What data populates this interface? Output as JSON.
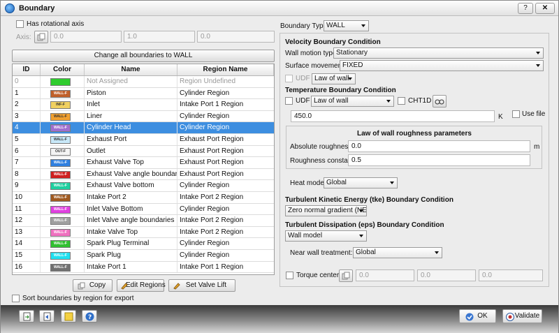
{
  "window": {
    "title": "Boundary",
    "help_label": "?",
    "close_label": "✕"
  },
  "left": {
    "rot_axis_label": "Has rotational axis",
    "axis_label": "Axis:",
    "axis_values": [
      "0.0",
      "1.0",
      "0.0"
    ],
    "change_all_label": "Change all boundaries to WALL",
    "table": {
      "headers": {
        "id": "ID",
        "color": "Color",
        "name": "Name",
        "region": "Region Name"
      },
      "rows": [
        {
          "id": "0",
          "tag": "",
          "color": "#2ecc2e",
          "name": "Not Assigned",
          "region": "Region Undefined"
        },
        {
          "id": "1",
          "tag": "WALL-F",
          "color": "#c0602a",
          "name": "Piston",
          "region": "Cylinder Region"
        },
        {
          "id": "2",
          "tag": "INF-F",
          "color": "#f0d060",
          "name": "Inlet",
          "region": "Intake Port 1 Region"
        },
        {
          "id": "3",
          "tag": "WALL-F",
          "color": "#f0a030",
          "name": "Liner",
          "region": "Cylinder Region"
        },
        {
          "id": "4",
          "tag": "WALL-F",
          "color": "#a070d0",
          "name": "Cylinder Head",
          "region": "Cylinder Region"
        },
        {
          "id": "5",
          "tag": "WALL-F",
          "color": "#c8e8f8",
          "name": "Exhaust Port",
          "region": "Exhaust Port Region"
        },
        {
          "id": "6",
          "tag": "OUT-F",
          "color": "#f4f4f4",
          "name": "Outlet",
          "region": "Exhaust Port Region"
        },
        {
          "id": "7",
          "tag": "WALL-F",
          "color": "#3080e0",
          "name": "Exhaust Valve Top",
          "region": "Exhaust Port Region"
        },
        {
          "id": "8",
          "tag": "WALL-F",
          "color": "#d02020",
          "name": "Exhaust Valve angle boundaries",
          "region": "Exhaust Port Region"
        },
        {
          "id": "9",
          "tag": "WALL-F",
          "color": "#20d0a0",
          "name": "Exhaust Valve bottom",
          "region": "Cylinder Region"
        },
        {
          "id": "10",
          "tag": "WALL-F",
          "color": "#a05a20",
          "name": "Intake Port 2",
          "region": "Intake Port 2 Region"
        },
        {
          "id": "11",
          "tag": "WALL-F",
          "color": "#e040e0",
          "name": "Inlet Valve Bottom",
          "region": "Cylinder Region"
        },
        {
          "id": "12",
          "tag": "WALL-F",
          "color": "#a0a0a0",
          "name": "Inlet Valve angle boundaries",
          "region": "Intake Port 2 Region"
        },
        {
          "id": "13",
          "tag": "WALL-F",
          "color": "#f070c0",
          "name": "Intake Valve Top",
          "region": "Intake Port 2 Region"
        },
        {
          "id": "14",
          "tag": "WALL-F",
          "color": "#30c030",
          "name": "Spark Plug Terminal",
          "region": "Cylinder Region"
        },
        {
          "id": "15",
          "tag": "WALL-F",
          "color": "#20e0f0",
          "name": "Spark Plug",
          "region": "Cylinder Region"
        },
        {
          "id": "16",
          "tag": "WALL-F",
          "color": "#707070",
          "name": "Intake Port 1",
          "region": "Intake Port 1 Region"
        }
      ],
      "selected_row": 4
    },
    "copy_label": "Copy",
    "edit_regions_label": "Edit Regions",
    "set_valve_lift_label": "Set Valve Lift",
    "sort_label": "Sort boundaries by region for export"
  },
  "right": {
    "boundary_type_label": "Boundary Type:",
    "boundary_type_value": "WALL",
    "velocity": {
      "title": "Velocity Boundary Condition",
      "wall_motion_label": "Wall motion type:",
      "wall_motion_value": "Stationary",
      "surface_movement_label": "Surface movement:",
      "surface_movement_value": "FIXED",
      "udf_label": "UDF",
      "law_value": "Law of wall"
    },
    "temperature": {
      "title": "Temperature Boundary Condition",
      "udf_label": "UDF",
      "law_value": "Law of wall",
      "cht_label": "CHT1D",
      "value": "450.0",
      "unit": "K",
      "use_file_label": "Use file",
      "roughness_title": "Law of wall roughness parameters",
      "abs_rough_label": "Absolute roughness:",
      "abs_rough_value": "0.0",
      "abs_rough_unit": "m",
      "rough_const_label": "Roughness constant:",
      "rough_const_value": "0.5",
      "heat_model_label": "Heat model:",
      "heat_model_value": "Global"
    },
    "tke": {
      "title": "Turbulent Kinetic Energy (tke) Boundary Condition",
      "value": "Zero normal gradient (NE)"
    },
    "eps": {
      "title": "Turbulent Dissipation (eps) Boundary Condition",
      "value": "Wall model",
      "near_wall_label": "Near wall treatment:",
      "near_wall_value": "Global"
    },
    "torque": {
      "label": "Torque center",
      "values": [
        "0.0",
        "0.0",
        "0.0"
      ]
    }
  },
  "footer": {
    "ok_label": "OK",
    "validate_label": "Validate"
  }
}
